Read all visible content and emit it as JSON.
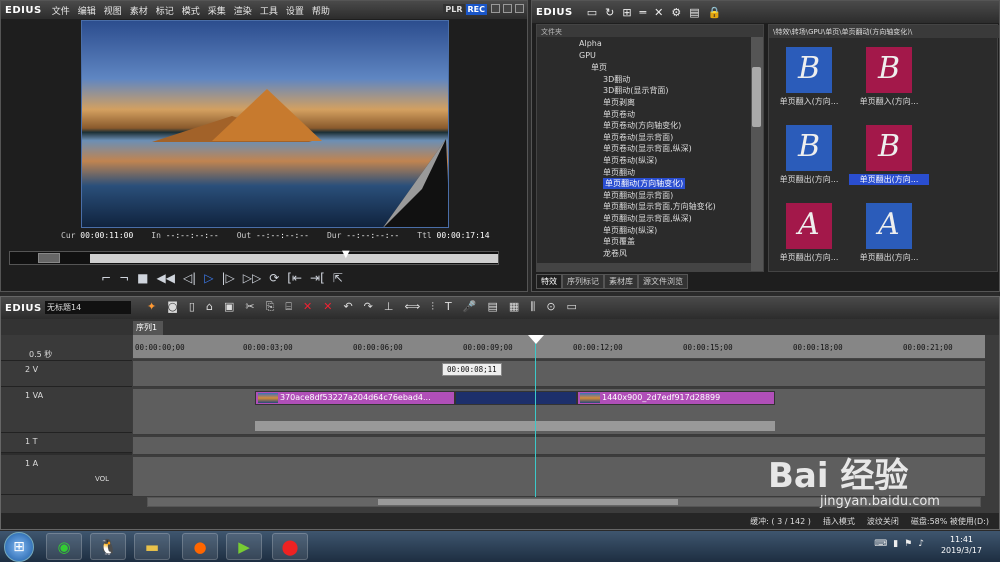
{
  "player": {
    "logo": "EDIUS",
    "menu": [
      "文件",
      "编辑",
      "视图",
      "素材",
      "标记",
      "模式",
      "采集",
      "渲染",
      "工具",
      "设置",
      "帮助"
    ],
    "plr": "PLR",
    "rec": "REC",
    "timecodes": {
      "cur_label": "Cur",
      "cur": "00:00:11:00",
      "in_label": "In",
      "in": "--:--:--:--",
      "out_label": "Out",
      "out": "--:--:--:--",
      "dur_label": "Dur",
      "dur": "--:--:--:--",
      "ttl_label": "Ttl",
      "ttl": "00:00:17:14"
    }
  },
  "bin": {
    "logo": "EDIUS",
    "tree_header": "文件夹",
    "tree": [
      {
        "label": "Alpha",
        "indent": 1
      },
      {
        "label": "GPU",
        "indent": 1
      },
      {
        "label": "单页",
        "indent": 2
      },
      {
        "label": "3D翻动",
        "indent": 3
      },
      {
        "label": "3D翻动(显示背面)",
        "indent": 3
      },
      {
        "label": "单页剥离",
        "indent": 3
      },
      {
        "label": "单页卷动",
        "indent": 3
      },
      {
        "label": "单页卷动(方向轴变化)",
        "indent": 3
      },
      {
        "label": "单页卷动(显示背面)",
        "indent": 3
      },
      {
        "label": "单页卷动(显示背面,纵深)",
        "indent": 3
      },
      {
        "label": "单页卷动(纵深)",
        "indent": 3
      },
      {
        "label": "单页翻动",
        "indent": 3
      },
      {
        "label": "单页翻动(方向轴变化)",
        "indent": 3,
        "selected": true
      },
      {
        "label": "单页翻动(显示背面)",
        "indent": 3
      },
      {
        "label": "单页翻动(显示背面,方向轴变化)",
        "indent": 3
      },
      {
        "label": "单页翻动(显示背面,纵深)",
        "indent": 3
      },
      {
        "label": "单页翻动(纵深)",
        "indent": 3
      },
      {
        "label": "单页覆盖",
        "indent": 3
      },
      {
        "label": "龙卷风",
        "indent": 3
      }
    ],
    "clip_path": "\\特效\\转场\\GPU\\单页\\单页翻动(方向轴变化)\\",
    "clips": [
      {
        "label": "单页翻入(方向...",
        "letter": "B",
        "color": "blue"
      },
      {
        "label": "单页翻入(方向...",
        "letter": "B",
        "color": "red"
      },
      {
        "label": "单页翻出(方向...",
        "letter": "B",
        "color": "blue"
      },
      {
        "label": "单页翻出(方向...",
        "letter": "B",
        "color": "red",
        "selected": true
      },
      {
        "label": "单页翻出(方向...",
        "letter": "A",
        "color": "red"
      },
      {
        "label": "单页翻出(方向...",
        "letter": "A",
        "color": "blue"
      }
    ],
    "tabs": [
      "特效",
      "序列标记",
      "素材库",
      "源文件浏览"
    ]
  },
  "timeline": {
    "logo": "EDIUS",
    "project_name": "无标题14",
    "sequence_tab": "序列1",
    "zoom": "0.5 秒",
    "ruler_ticks": [
      "00:00:00;00",
      "00:00:03;00",
      "00:00:06;00",
      "00:00:09;00",
      "00:00:12;00",
      "00:00:15;00",
      "00:00:18;00",
      "00:00:21;00"
    ],
    "tooltip": "00:00:08;11",
    "tracks": [
      {
        "name": "2 V"
      },
      {
        "name": "1 VA"
      },
      {
        "name": "1 T"
      },
      {
        "name": "1 A"
      }
    ],
    "vol_label": "VOL",
    "clip1": "370ace8df53227a204d64c76ebad4...",
    "clip2": "1440x900_2d7edf917d28899",
    "status": {
      "buffer": "缓冲:",
      "buffer_val": "3 / 142",
      "insert": "插入模式",
      "ripple": "波纹关闭",
      "disk": "磁盘:58% 被使用(D:)"
    }
  },
  "taskbar": {
    "time": "11:41",
    "date": "2019/3/17"
  },
  "watermark": {
    "text": "Bai 经验",
    "url": "jingyan.baidu.com"
  }
}
